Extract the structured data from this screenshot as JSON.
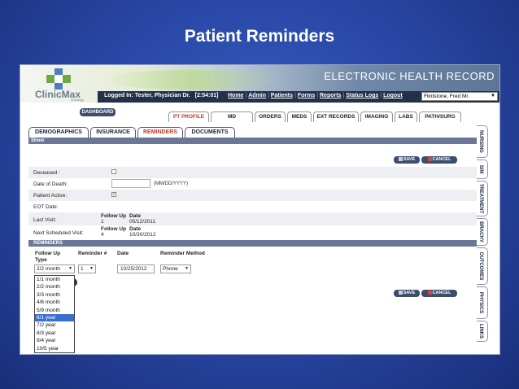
{
  "slide": {
    "title": "Patient Reminders"
  },
  "header": {
    "logo_text": "ClinicMax",
    "logo_sub": "oncology",
    "app_title": "ELECTRONIC HEALTH RECORD",
    "logged_in": "Logged In: Tester, Physician Dr.",
    "timer": "[2:54:01]",
    "nav": [
      "Home",
      "Admin",
      "Patients",
      "Forms",
      "Reports",
      "Status Logs",
      "Logout"
    ],
    "patient": "Flintstone, Fred Mr."
  },
  "dashboard_label": "DASHBOARD",
  "top_tabs": [
    "PT PROFILE",
    "MD",
    "ORDERS",
    "MEDS",
    "EXT RECORDS",
    "IMAGING",
    "LABS",
    "PATH/SURG"
  ],
  "sub_tabs": [
    "DEMOGRAPHICS",
    "INSURANCE",
    "REMINDERS",
    "DOCUMENTS"
  ],
  "show_label": "Show",
  "side_tabs": [
    "NURSING",
    "SIM",
    "TREATMENT",
    "BRACHY",
    "OUTCOMES",
    "PHYSICS",
    "LINKS"
  ],
  "buttons": {
    "save": "SAVE",
    "cancel": "CANCEL"
  },
  "form": {
    "deceased_label": "Deceased :",
    "dod_label": "Date of Death:",
    "dod_hint": "(MM/DD/YYYY)",
    "active_label": "Patient Active:",
    "active_check": "✓",
    "eot_label": "EOT Date:",
    "last_visit_label": "Last Visit:",
    "next_visit_label": "Next Scheduled Visit:",
    "fu_head": "Follow Up",
    "date_head": "Date",
    "last_fu": "1",
    "last_date": "05/12/2011",
    "next_fu": "4",
    "next_date": "10/30/2012"
  },
  "reminders": {
    "bar": "REMINDERS",
    "col_type": "Follow Up Type",
    "col_num": "Reminder #",
    "col_date": "Date",
    "col_method": "Reminder Method",
    "type_value": "2/2 month",
    "num_value": "1",
    "date_value": "10/25/2012",
    "method_value": "Phone",
    "options": [
      "1/1 month",
      "2/2 month",
      "3/3 month",
      "4/6 month",
      "5/9 month",
      "6/1 year",
      "7/2 year",
      "8/3 year",
      "9/4 year",
      "10/5 year"
    ],
    "highlighted": "6/1 year"
  }
}
